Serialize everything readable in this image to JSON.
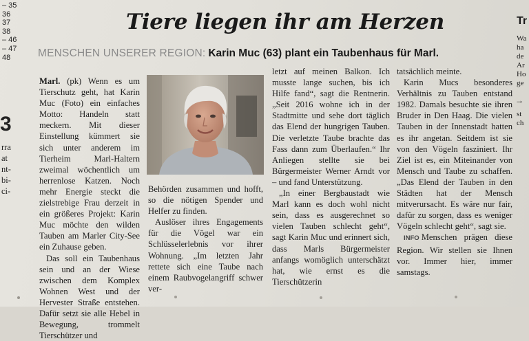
{
  "margin": {
    "numbers": [
      "– 35",
      "36",
      "37",
      "38",
      "– 46",
      "– 47",
      "48"
    ],
    "big_number": "3",
    "fragments": [
      "rra",
      "at",
      "nt-",
      "bi-",
      "ci-"
    ]
  },
  "right_edge": {
    "title": "Tr",
    "lines": [
      "Wa",
      "ha",
      "de",
      "Ar",
      "Ho",
      "ge"
    ],
    "arrow": "→",
    "lines2": [
      "st",
      "ch"
    ]
  },
  "article": {
    "headline": "Tiere liegen ihr am Herzen",
    "kicker": "MENSCHEN UNSERER REGION:",
    "subheadline": "Karin Muc (63) plant ein Taubenhaus für Marl.",
    "col1": {
      "p1_dateline": "Marl.",
      "p1": "(pk) Wenn es um Tierschutz geht, hat Karin Muc (Foto) ein einfaches Motto: Handeln statt meckern. Mit dieser Einstellung kümmert sie sich unter anderem im Tierheim Marl-Haltern zweimal wöchentlich um herrenlose Katzen. Noch mehr Energie steckt die zielstrebige Frau derzeit in ein größeres Projekt: Karin Muc möchte den wilden Tauben am Marler City-See ein Zuhause geben.",
      "p2": "Das soll ein Taubenhaus sein und an der Wiese zwischen dem Komplex Wohnen West und der Hervester Straße entstehen. Dafür setzt sie alle Hebel in Bewegung, trommelt Tierschützer und"
    },
    "col2": {
      "p1": "Behörden zusammen und hofft, so die nötigen Spender und Helfer zu finden.",
      "p2": "Auslöser ihres Engagements für die Vögel war ein Schlüsselerlebnis vor ihrer Wohnung. „Im letzten Jahr rettete sich eine Taube nach einem Raubvogelangriff schwer ver-"
    },
    "col3": {
      "p1": "letzt auf meinen Balkon. Ich musste lange suchen, bis ich Hilfe fand“, sagt die Rentnerin. „Seit 2016 wohne ich in der Stadtmitte und sehe dort täglich das Elend der hungrigen Tauben. Die verletzte Taube brachte das Fass dann zum Überlaufen.“ Ihr Anliegen stellte sie bei Bürgermeister Werner Arndt vor – und fand Unterstützung.",
      "p2": "„In einer Bergbaustadt wie Marl kann es doch wohl nicht sein, dass es ausgerechnet so vielen Tauben schlecht geht“, sagt Karin Muc und erinnert sich, dass Marls Bürgermeister anfangs womöglich unterschätzt hat, wie ernst es die Tierschützerin"
    },
    "col4": {
      "p1": "tatsächlich meinte.",
      "p2": "Karin Mucs besonderes Verhältnis zu Tauben entstand 1982. Damals besuchte sie ihren Bruder in Den Haag. Die vielen Tauben in der Innenstadt hatten es ihr angetan. Seitdem ist sie von den Vögeln fasziniert. Ihr Ziel ist es, ein Miteinander von Mensch und Taube zu schaffen. „Das Elend der Tauben in den Städten hat der Mensch mitverursacht. Es wäre nur fair, dafür zu sorgen, dass es weniger Vögeln schlecht geht“, sagt sie.",
      "info_label": "INFO",
      "info_text": "Menschen prägen diese Region. Wir stellen sie Ihnen vor. Immer hier, immer samstags."
    }
  },
  "colors": {
    "paper": "#e4e2dc",
    "ink": "#1b1b1b",
    "kicker_gray": "#8a8a8a"
  }
}
